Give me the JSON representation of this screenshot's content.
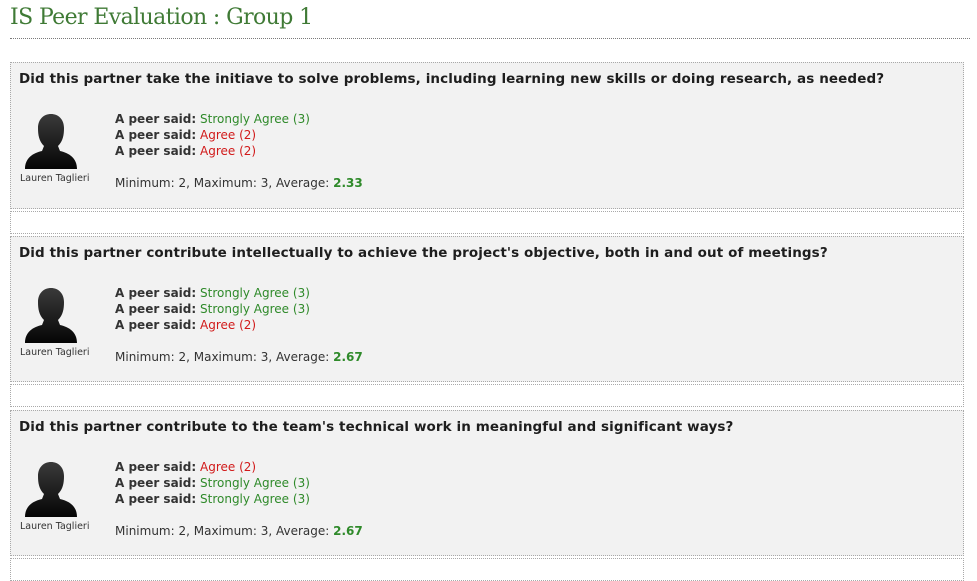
{
  "page_title": "IS Peer Evaluation : Group 1",
  "colors": {
    "title": "#3f7a35",
    "strongly_agree": "#2f8a2a",
    "agree": "#d11a1a",
    "average": "#2f8a2a",
    "card_bg": "#f2f2f2"
  },
  "evaluations": [
    {
      "question": "Did this partner take the initiave to solve problems, including learning new skills or doing research, as needed?",
      "peer_name": "Lauren Taglieri",
      "avatar_icon": "user-silhouette-icon",
      "responses": [
        {
          "prefix": "A peer said:",
          "answer": "Strongly Agree (3)"
        },
        {
          "prefix": "A peer said:",
          "answer": "Agree (2)"
        },
        {
          "prefix": "A peer said:",
          "answer": "Agree (2)"
        }
      ],
      "stats_text": "Minimum: 2, Maximum: 3, Average:",
      "average": "2.33"
    },
    {
      "question": "Did this partner contribute intellectually to achieve the project's objective, both in and out of meetings?",
      "peer_name": "Lauren Taglieri",
      "avatar_icon": "user-silhouette-icon",
      "responses": [
        {
          "prefix": "A peer said:",
          "answer": "Strongly Agree (3)"
        },
        {
          "prefix": "A peer said:",
          "answer": "Strongly Agree (3)"
        },
        {
          "prefix": "A peer said:",
          "answer": "Agree (2)"
        }
      ],
      "stats_text": "Minimum: 2, Maximum: 3, Average:",
      "average": "2.67"
    },
    {
      "question": "Did this partner contribute to the team's technical work in meaningful and significant ways?",
      "peer_name": "Lauren Taglieri",
      "avatar_icon": "user-silhouette-icon",
      "responses": [
        {
          "prefix": "A peer said:",
          "answer": "Agree (2)"
        },
        {
          "prefix": "A peer said:",
          "answer": "Strongly Agree (3)"
        },
        {
          "prefix": "A peer said:",
          "answer": "Strongly Agree (3)"
        }
      ],
      "stats_text": "Minimum: 2, Maximum: 3, Average:",
      "average": "2.67"
    }
  ]
}
